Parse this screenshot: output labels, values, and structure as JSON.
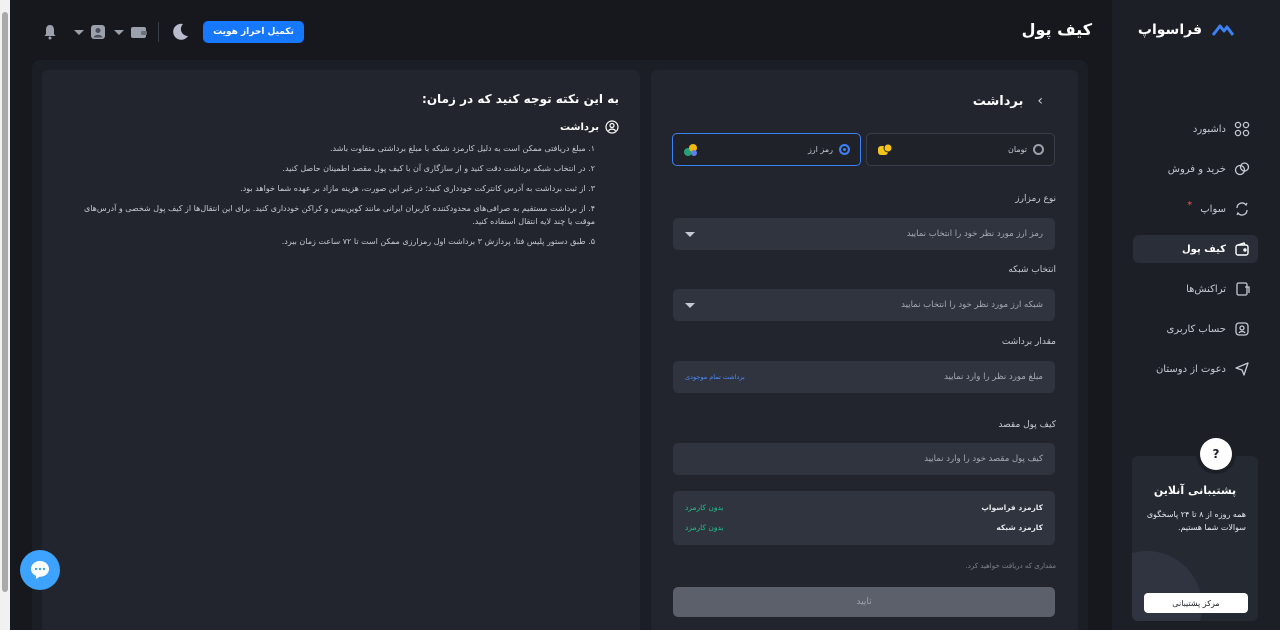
{
  "brand": {
    "name": "فراسواپ"
  },
  "sidebar": {
    "items": [
      {
        "label": "داشبورد",
        "icon": "grid-icon"
      },
      {
        "label": "خرید و فروش",
        "icon": "exchange-icon"
      },
      {
        "label": "سواپ",
        "icon": "swap-icon",
        "badge": "*"
      },
      {
        "label": "کیف پول",
        "icon": "wallet-icon",
        "active": true
      },
      {
        "label": "تراکنش‌ها",
        "icon": "receipt-icon"
      },
      {
        "label": "حساب کاربری",
        "icon": "user-icon"
      },
      {
        "label": "دعوت از دوستان",
        "icon": "send-icon"
      }
    ]
  },
  "support": {
    "q": "?",
    "title": "پشتیبانی آنلاین",
    "desc": "همه روزه از ۸ تا ۲۴ پاسخگوی سوالات شما هستیم.",
    "button": "مرکز پشتیبانی"
  },
  "topbar": {
    "title": "کیف پول",
    "kyc_button": "تکمیل احراز هویت"
  },
  "withdraw": {
    "title": "برداشت",
    "options": [
      {
        "label": "تومان",
        "selected": false
      },
      {
        "label": "رمز ارز",
        "selected": true
      }
    ],
    "crypto_label": "نوع رمزارز",
    "crypto_placeholder": "رمز ارز مورد نظر خود را انتخاب نمایید",
    "network_label": "انتخاب شبکه",
    "network_placeholder": "شبکه ارز مورد نظر خود را انتخاب نمایید",
    "amount_label": "مقدار برداشت",
    "amount_placeholder": "مبلغ مورد نظر را وارد نمایید",
    "amount_link": "برداشت تمام موجودی",
    "dest_label": "کیف پول مقصد",
    "dest_placeholder": "کیف پول مقصد خود را وارد نمایید",
    "fees": [
      {
        "k": "کارمزد فراسواپ",
        "v": "بدون کارمزد"
      },
      {
        "k": "کارمزد شبکه",
        "v": "بدون کارمزد"
      }
    ],
    "receive_text": "مقداری که دریافت خواهید کرد.",
    "submit": "تایید"
  },
  "notes": {
    "title": "به این نکته توجه کنید که در زمان:",
    "subtitle": "برداشت",
    "items": [
      "۱. مبلغ دریافتی ممکن است به دلیل کارمزد شبکه با مبلغ برداشتی متفاوت باشد.",
      "۲. در انتخاب شبکه برداشت دقت کنید و از سازگاری آن با کیف پول مقصد اطمینان حاصل کنید.",
      "۳. از ثبت برداشت به آدرس کانترکت خودداری کنید؛ در غیر این صورت، هزینه مازاد بر عهده شما خواهد بود.",
      "۴. از برداشت مستقیم به صرافی‌های محدودکننده کاربران ایرانی مانند کوین‌بیس و کراکن خودداری کنید. برای این انتقال‌ها از کیف پول شخصی و آدرس‌های موقت یا چند لایه انتقال استفاده کنید.",
      "۵. طبق دستور پلیس فتا، پردازش ۳ برداشت اول رمزارزی ممکن است تا ۷۲ ساعت زمان ببرد."
    ]
  },
  "colors": {
    "accent": "#1677ff",
    "success": "#21c28e",
    "bg": "#16181d",
    "panel": "#22252d"
  }
}
